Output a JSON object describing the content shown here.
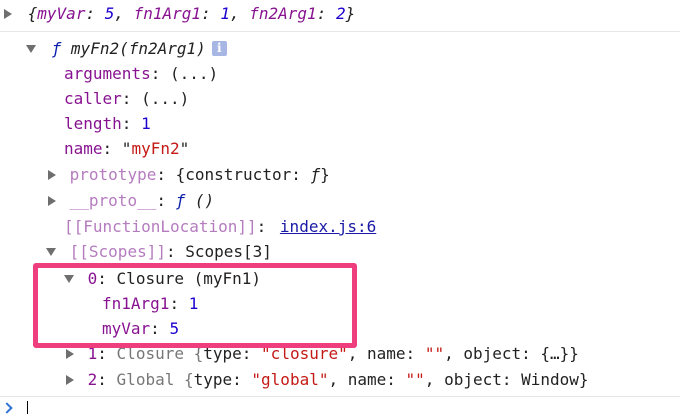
{
  "console": {
    "summary_line": {
      "open": "{",
      "items": [
        {
          "key": "myVar",
          "sep": ": ",
          "value": "5",
          "after": ", "
        },
        {
          "key": "fn1Arg1",
          "sep": ": ",
          "value": "1",
          "after": ", "
        },
        {
          "key": "fn2Arg1",
          "sep": ": ",
          "value": "2",
          "after": ""
        }
      ],
      "close": "}"
    },
    "function_header": {
      "keyword": "ƒ",
      "signature": "myFn2(fn2Arg1)",
      "info_icon_glyph": "i"
    },
    "properties": [
      {
        "key": "arguments",
        "sep": ": ",
        "value": "(...)"
      },
      {
        "key": "caller",
        "sep": ": ",
        "value": "(...)"
      },
      {
        "key": "length",
        "sep": ": ",
        "value": "1"
      },
      {
        "key": "name",
        "sep": ": ",
        "value_open": "\"",
        "value": "myFn2",
        "value_close": "\""
      }
    ],
    "prototype": {
      "key": "prototype",
      "sep": ": ",
      "open": "{",
      "inner_key": "constructor",
      "inner_sep": ": ",
      "inner_value": "ƒ",
      "close": "}"
    },
    "proto": {
      "key": "__proto__",
      "sep": ": ",
      "keyword": "ƒ",
      "value": "()"
    },
    "function_location": {
      "key": "[[FunctionLocation]]",
      "sep": ": ",
      "link": "index.js:6"
    },
    "scopes": {
      "key": "[[Scopes]]",
      "sep": ": ",
      "value": "Scopes[3]",
      "entries": [
        {
          "index": "0",
          "sep": ": ",
          "label": "Closure (myFn1)",
          "children": [
            {
              "key": "fn1Arg1",
              "sep": ": ",
              "value": "1"
            },
            {
              "key": "myVar",
              "sep": ": ",
              "value": "5"
            }
          ]
        },
        {
          "index": "1",
          "sep": ": ",
          "prefix": "Closure {",
          "type_key": "type",
          "type_sep": ": ",
          "type_value": "\"closure\"",
          "comma1": ", ",
          "name_key": "name",
          "name_sep": ": ",
          "name_value": "\"\"",
          "comma2": ", ",
          "object_key": "object",
          "object_sep": ": ",
          "object_value": "{…}}"
        },
        {
          "index": "2",
          "sep": ": ",
          "prefix": "Global {",
          "type_key": "type",
          "type_sep": ": ",
          "type_value": "\"global\"",
          "comma1": ", ",
          "name_key": "name",
          "name_sep": ": ",
          "name_value": "\"\"",
          "comma2": ", ",
          "object_key": "object",
          "object_sep": ": ",
          "object_value": "Window}"
        }
      ]
    }
  },
  "colors": {
    "highlight": "#ee3e7e",
    "property_key": "#881391",
    "number": "#1c00cf",
    "string": "#c41a16",
    "link": "#1a1aa6",
    "prompt_arrow": "#2f73d8"
  }
}
